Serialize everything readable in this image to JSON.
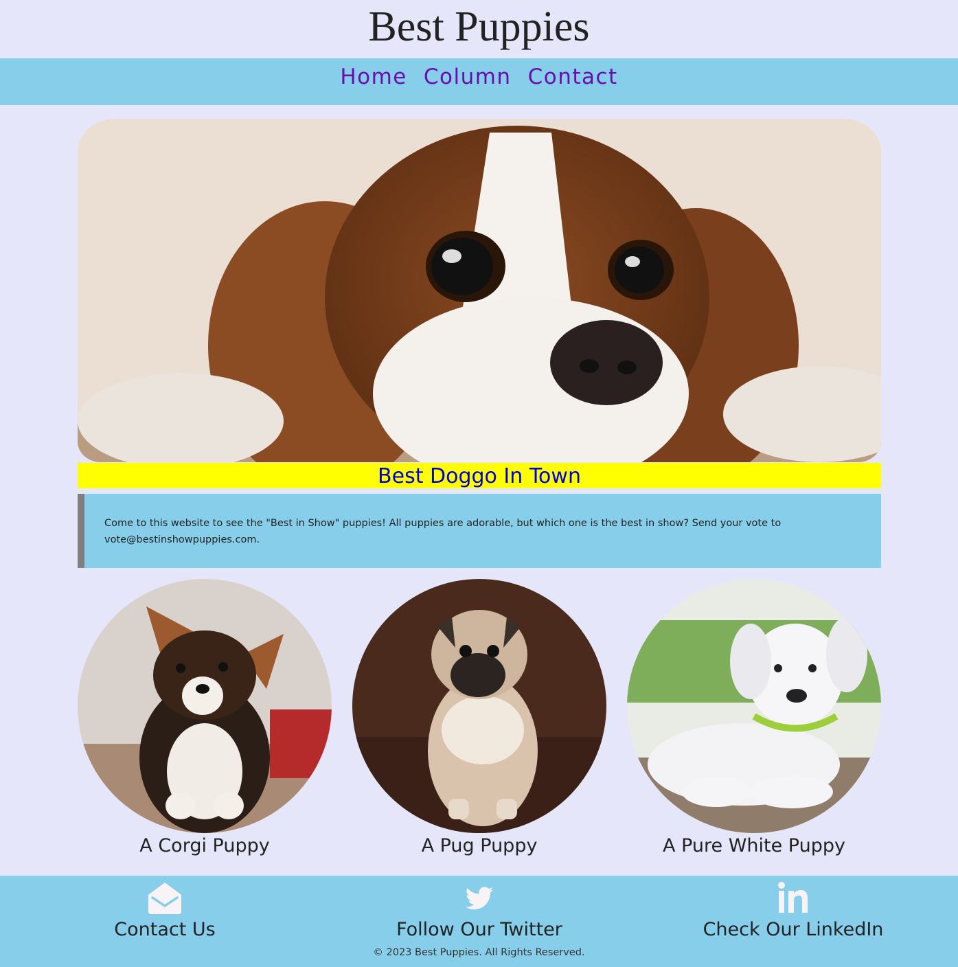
{
  "site": {
    "title": "Best Puppies"
  },
  "nav": {
    "items": [
      "Home",
      "Column",
      "Contact"
    ]
  },
  "hero": {
    "caption": "Best Doggo In Town"
  },
  "intro": {
    "text": "Come to this website to see the \"Best in Show\" puppies! All puppies are adorable, but which one is the best in show? Send your vote to vote@bestinshowpuppies.com."
  },
  "puppies": [
    {
      "caption": "A Corgi Puppy"
    },
    {
      "caption": "A Pug Puppy"
    },
    {
      "caption": "A Pure White Puppy"
    }
  ],
  "footer": {
    "links": [
      {
        "label": "Contact Us",
        "icon": "envelope-open-icon"
      },
      {
        "label": "Follow Our Twitter",
        "icon": "twitter-icon"
      },
      {
        "label": "Check Our LinkedIn",
        "icon": "linkedin-icon"
      }
    ],
    "copyright": "© 2023 Best Puppies. All Rights Reserved."
  },
  "colors": {
    "page_bg": "#e6e6fa",
    "nav_bg": "#87ceeb",
    "nav_link": "#6a0dad",
    "caption_bg": "#ffff00",
    "caption_text": "#0000dd"
  }
}
